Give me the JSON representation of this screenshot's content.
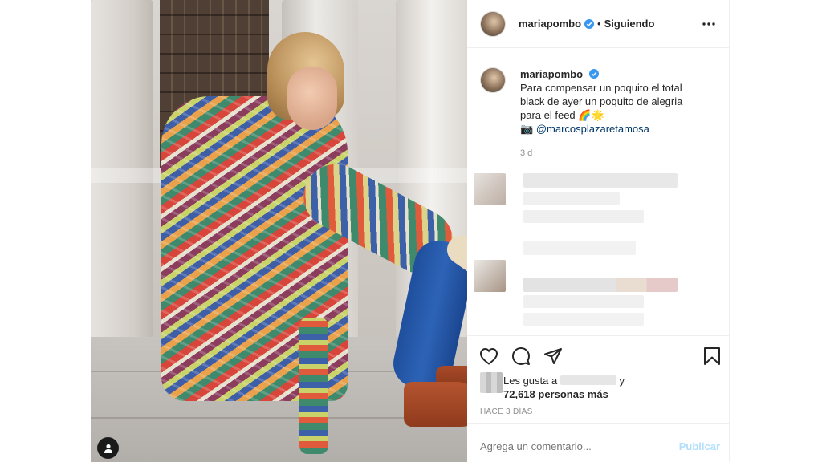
{
  "post": {
    "username": "mariapombo",
    "separator": "•",
    "follow_status": "Siguiendo",
    "caption": {
      "username": "mariapombo",
      "line1": "Para compensar un poquito el total",
      "line2": "black de ayer un poquito de alegria",
      "line3": "para el feed 🌈🌟",
      "camera": "📷",
      "mention": "@marcosplazaretamosa"
    },
    "caption_time": "3 d",
    "likes": {
      "prefix": "Les gusta a",
      "suffix": "y",
      "count_text": "72,618 personas más"
    },
    "posted_ago": "HACE 3 DÍAS",
    "comment_placeholder": "Agrega un comentario...",
    "publish_label": "Publicar"
  },
  "icons": {
    "verified": "verified-badge-icon",
    "more": "more-options-icon",
    "like": "heart-icon",
    "comment": "comment-icon",
    "share": "share-icon",
    "save": "bookmark-icon",
    "user_tag": "user-tag-icon"
  },
  "colors": {
    "verified_blue": "#3897f0",
    "link": "#00376b",
    "muted": "#8e8e8e",
    "publish_disabled": "#b2dffc"
  }
}
